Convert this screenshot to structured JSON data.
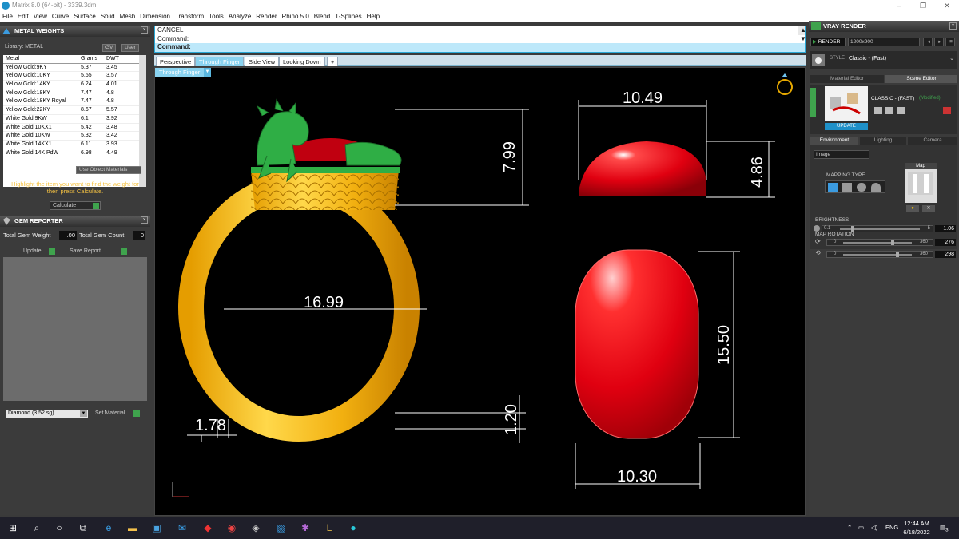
{
  "window": {
    "title": "Matrix 8.0 (64-bit) - 3339.3dm",
    "minimize": "–",
    "restore": "❐",
    "close": "✕"
  },
  "menu": [
    "File",
    "Edit",
    "View",
    "Curve",
    "Surface",
    "Solid",
    "Mesh",
    "Dimension",
    "Transform",
    "Tools",
    "Analyze",
    "Render",
    "Rhino 5.0",
    "Blend",
    "T-Splines",
    "Help"
  ],
  "metal_weights": {
    "title": "METAL WEIGHTS",
    "library_label": "Library: METAL",
    "btn_gv": "GV",
    "btn_user": "User",
    "columns": [
      "Metal",
      "Grams",
      "DWT"
    ],
    "rows": [
      [
        "Yellow Gold:9KY",
        "5.37",
        "3.45"
      ],
      [
        "Yellow Gold:10KY",
        "5.55",
        "3.57"
      ],
      [
        "Yellow Gold:14KY",
        "6.24",
        "4.01"
      ],
      [
        "Yellow Gold:18KY",
        "7.47",
        "4.8"
      ],
      [
        "Yellow Gold:18KY Royal",
        "7.47",
        "4.8"
      ],
      [
        "Yellow Gold:22KY",
        "8.67",
        "5.57"
      ],
      [
        "White Gold:9KW",
        "6.1",
        "3.92"
      ],
      [
        "White Gold:10KX1",
        "5.42",
        "3.48"
      ],
      [
        "White Gold:10KW",
        "5.32",
        "3.42"
      ],
      [
        "White Gold:14KX1",
        "6.11",
        "3.93"
      ],
      [
        "White Gold:14K PdW",
        "6.98",
        "4.49"
      ]
    ],
    "use_object_materials": "Use Object Materials",
    "hint": "Highlight the item you want to find the weight for then press Calculate.",
    "calculate": "Calculate"
  },
  "gem_reporter": {
    "title": "GEM REPORTER",
    "total_gem_weight_label": "Total Gem Weight",
    "total_gem_weight": ".00",
    "total_gem_count_label": "Total Gem Count",
    "total_gem_count": "0",
    "update": "Update",
    "save_report": "Save Report",
    "gem_select": "Diamond   (3.52 sg)",
    "set_material": "Set Material"
  },
  "command": {
    "line1": "CANCEL",
    "line2": "Command:",
    "prompt": "Command:"
  },
  "viewport_tabs": [
    "Perspective",
    "Through Finger",
    "Side View",
    "Looking Down"
  ],
  "active_tab_index": 1,
  "viewport_label": "Through Finger",
  "dimensions": {
    "top_width": "10.49",
    "ring_height": "7.99",
    "stone_height": "4.86",
    "inner_diameter": "16.99",
    "stone_length": "15.50",
    "shank_thickness": "1.78",
    "band_height": "1.20",
    "stone_width": "10.30"
  },
  "vray": {
    "title": "VRAY RENDER",
    "render": "RENDER",
    "resolution": "1200x900",
    "style_label": "STYLE",
    "style": "Classic - (Fast)",
    "material_editor": "Material Editor",
    "scene_editor": "Scene Editor",
    "preset": "CLASSIC - (FAST)",
    "modified": "(Modified)",
    "update": "UPDATE",
    "tabs": [
      "Environment",
      "Lighting",
      "Camera"
    ],
    "env_type": "Image",
    "mapping_type": "MAPPING TYPE",
    "map_label": "Map",
    "brightness_label": "BRIGHTNESS",
    "brightness_min": "0.1",
    "brightness_max": "5",
    "brightness": "1.06",
    "map_rotation_label": "MAP ROTATION",
    "rot_min": "0",
    "rot_max": "360",
    "rotation1": "276",
    "rotation2": "298"
  },
  "taskbar": {
    "language": "ENG",
    "time": "12:44 AM",
    "date": "6/18/2022",
    "notifications": "3"
  },
  "colors": {
    "accent": "#2aa8d6",
    "gold": "#f0b818",
    "stone": "#e00010",
    "dragon": "#2fae45",
    "green_btn": "#3fa34d",
    "hint": "#f5c242"
  }
}
